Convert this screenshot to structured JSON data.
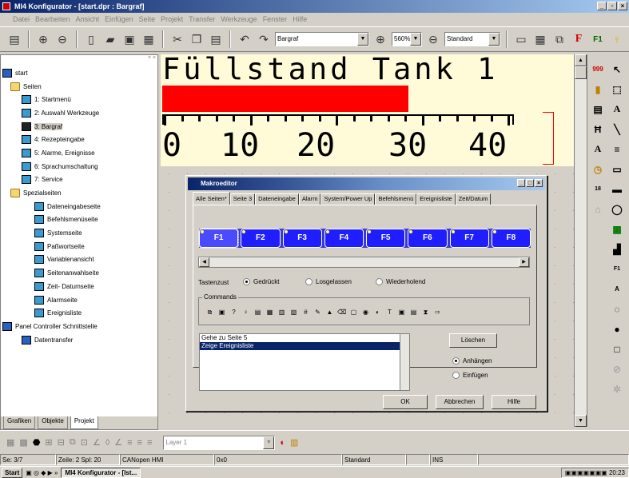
{
  "window": {
    "title": "MI4 Konfigurator - [start.dpr : Bargraf]"
  },
  "menu": [
    "Datei",
    "Bearbeiten",
    "Ansicht",
    "Einfügen",
    "Seite",
    "Projekt",
    "Transfer",
    "Werkzeuge",
    "Fenster",
    "Hilfe"
  ],
  "toolbar": {
    "page_combo": "Bargraf",
    "zoom": "560%",
    "layer_combo": "Standard"
  },
  "tree": {
    "items": [
      {
        "label": "start",
        "level": 0,
        "icon": "root"
      },
      {
        "label": "Seiten",
        "level": 1,
        "icon": "folder"
      },
      {
        "label": "1: Startmenü",
        "level": 2,
        "icon": "page"
      },
      {
        "label": "2: Auswahl Werkzeuge",
        "level": 2,
        "icon": "page"
      },
      {
        "label": "3: Bargraf",
        "level": 2,
        "icon": "page-selected"
      },
      {
        "label": "4: Rezepteingabe",
        "level": 2,
        "icon": "page"
      },
      {
        "label": "5: Alarme, Ereignisse",
        "level": 2,
        "icon": "page"
      },
      {
        "label": "6: Sprachumschaltung",
        "level": 2,
        "icon": "page"
      },
      {
        "label": "7: Service",
        "level": 2,
        "icon": "page"
      },
      {
        "label": "Spezialseiten",
        "level": 1,
        "icon": "folder"
      },
      {
        "label": "Dateneingabeseite",
        "level": 3,
        "icon": "page"
      },
      {
        "label": "Befehlsmenüseite",
        "level": 3,
        "icon": "page"
      },
      {
        "label": "Systemseite",
        "level": 3,
        "icon": "page"
      },
      {
        "label": "Paßwortseite",
        "level": 3,
        "icon": "page"
      },
      {
        "label": "Variablenansicht",
        "level": 3,
        "icon": "page"
      },
      {
        "label": "Seitenanwahlseite",
        "level": 3,
        "icon": "page"
      },
      {
        "label": "Zeit- Datumseite",
        "level": 3,
        "icon": "page"
      },
      {
        "label": "Alarmseite",
        "level": 3,
        "icon": "page"
      },
      {
        "label": "Ereignisliste",
        "level": 3,
        "icon": "page"
      },
      {
        "label": "Panel Controller Schnittstelle",
        "level": 0,
        "icon": "root"
      },
      {
        "label": "Datentransfer",
        "level": 2,
        "icon": "root"
      }
    ],
    "tabs": [
      "Grafiken",
      "Objekte",
      "Projekt"
    ]
  },
  "canvas": {
    "title_text": "Füllstand Tank 1",
    "bar_fill_fraction": 0.6,
    "scale_numbers": [
      "0",
      "10",
      "20",
      "30",
      "40"
    ]
  },
  "dialog": {
    "title": "Makroeditor",
    "tabs": [
      "Alle Seiten*",
      "Seite 3",
      "Dateneingabe",
      "Alarm",
      "System/Power Up",
      "Befehlsmenü",
      "Ereignisliste",
      "Zeit/Datum"
    ],
    "fkeys": [
      "F1",
      "F2",
      "F3",
      "F4",
      "F5",
      "F6",
      "F7",
      "F8"
    ],
    "tastenzust_label": "Tastenzust",
    "key_states": [
      "Gedrückt",
      "Losgelassen",
      "Wiederholend"
    ],
    "commands_label": "Commands",
    "macro_list": [
      "Gehe zu Seite 5",
      "Zeige Ereignisliste"
    ],
    "delete_button": "Löschen",
    "insert_modes": [
      "Anhängen",
      "Einfügen"
    ],
    "ok_button": "OK",
    "cancel_button": "Abbrechen",
    "help_button": "Hilfe"
  },
  "bottom_toolbar": {
    "layer_combo": "Layer 1"
  },
  "status": {
    "page": "Se: 3/7",
    "position": "Zeile: 2 Spl: 20",
    "protocol": "CANopen HMI",
    "coords": "0x0",
    "layer": "Standard",
    "mode": "INS"
  },
  "taskbar": {
    "start": "Start",
    "task": "MI4 Konfigurator - [Ist...",
    "clock": "20:23"
  }
}
